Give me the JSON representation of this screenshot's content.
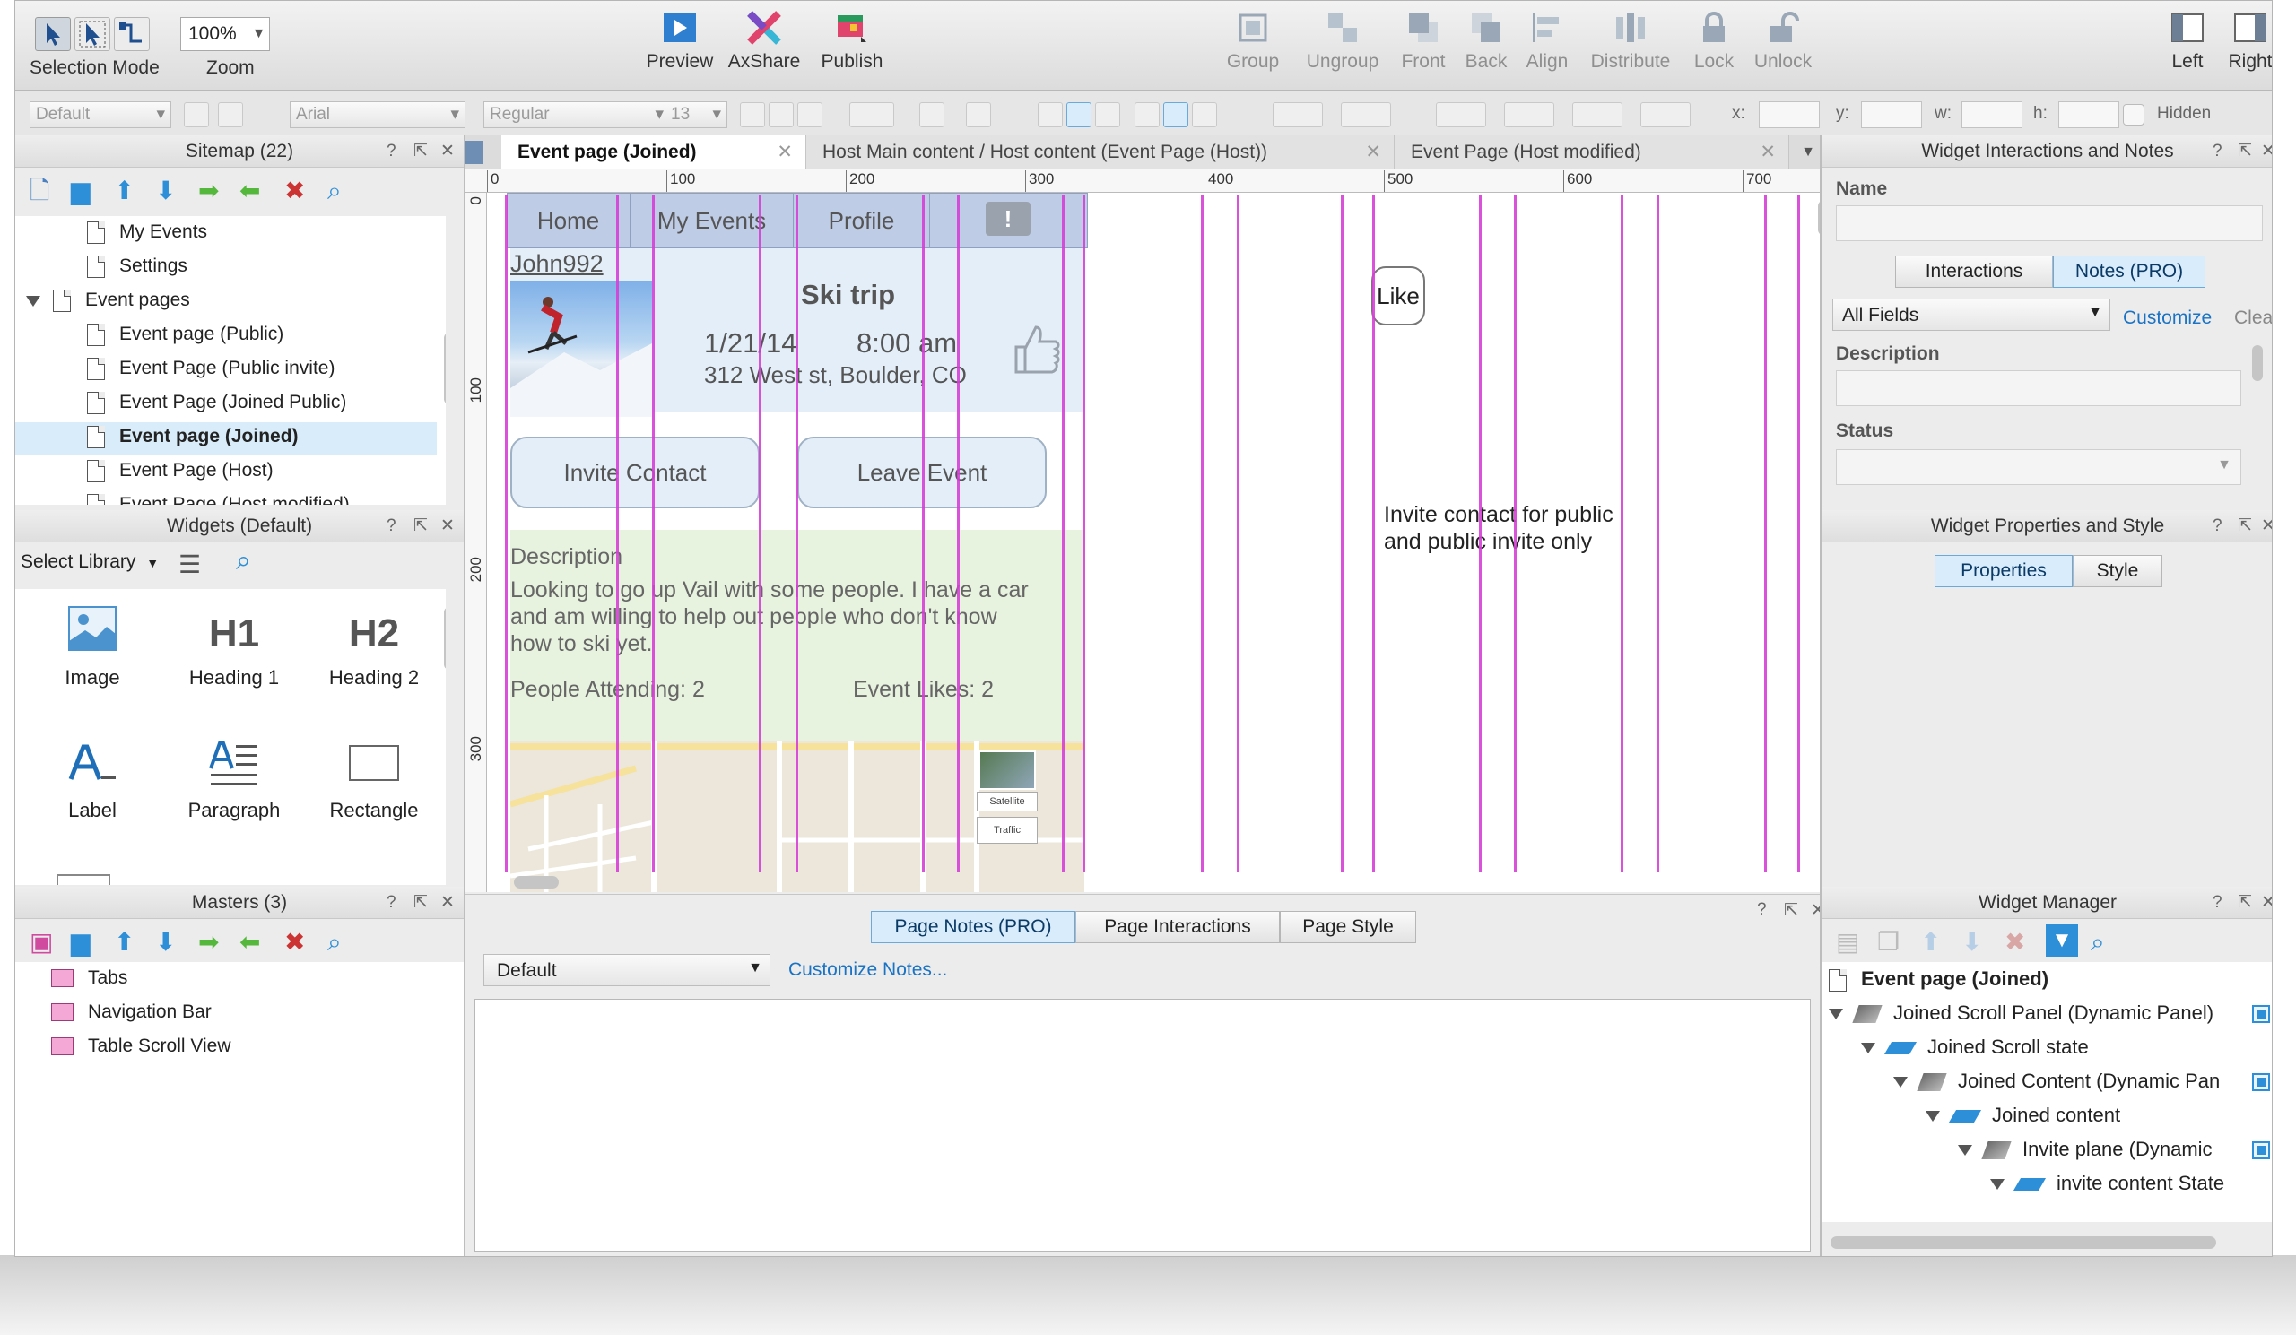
{
  "toolbar": {
    "selection_mode": "Selection Mode",
    "zoom_value": "100%",
    "zoom_label": "Zoom",
    "preview": "Preview",
    "axshare": "AxShare",
    "publish": "Publish",
    "group": "Group",
    "ungroup": "Ungroup",
    "front": "Front",
    "back": "Back",
    "align": "Align",
    "distribute": "Distribute",
    "lock": "Lock",
    "unlock": "Unlock",
    "left": "Left",
    "right": "Right"
  },
  "formatbar": {
    "style": "Default",
    "font": "Arial",
    "weight": "Regular",
    "size": "13",
    "x_label": "x:",
    "y_label": "y:",
    "w_label": "w:",
    "h_label": "h:",
    "hidden_label": "Hidden"
  },
  "sitemap": {
    "title": "Sitemap (22)",
    "items": [
      {
        "label": "My Events"
      },
      {
        "label": "Settings"
      },
      {
        "label": "Event pages"
      },
      {
        "label": "Event page (Public)"
      },
      {
        "label": "Event Page (Public invite)"
      },
      {
        "label": "Event Page (Joined Public)"
      },
      {
        "label": "Event page (Joined)"
      },
      {
        "label": "Event Page (Host)"
      },
      {
        "label": "Event Page (Host modified)"
      }
    ]
  },
  "widgets": {
    "title": "Widgets (Default)",
    "select_library": "Select Library",
    "items": [
      {
        "label": "Image"
      },
      {
        "label": "Heading 1",
        "glyph": "H1"
      },
      {
        "label": "Heading 2",
        "glyph": "H2"
      },
      {
        "label": "Label"
      },
      {
        "label": "Paragraph"
      },
      {
        "label": "Rectangle"
      }
    ]
  },
  "masters": {
    "title": "Masters (3)",
    "items": [
      {
        "label": "Tabs"
      },
      {
        "label": "Navigation Bar"
      },
      {
        "label": "Table Scroll View"
      }
    ]
  },
  "tabs": [
    {
      "label": "Event page (Joined)"
    },
    {
      "label": "Host Main content / Host content (Event Page (Host))"
    },
    {
      "label": "Event Page (Host modified)"
    }
  ],
  "ruler": {
    "h_ticks": [
      "0",
      "100",
      "200",
      "300",
      "400",
      "500",
      "600",
      "700"
    ],
    "v_ticks": [
      "0",
      "100",
      "200",
      "300"
    ]
  },
  "canvas": {
    "nav": [
      "Home",
      "My Events",
      "Profile"
    ],
    "username": "John992",
    "event_title": "Ski trip",
    "date": "1/21/14",
    "time": "8:00 am",
    "address": "312 West st, Boulder, CO",
    "invite_button": "Invite Contact",
    "leave_button": "Leave Event",
    "description_label": "Description",
    "description_text": "Looking to go up Vail with some people. I have a car and am willing to help out people who don't know how to ski yet.",
    "people_attending": "People Attending: 2",
    "event_likes": "Event Likes: 2",
    "like_button": "Like",
    "annotation": "Invite contact for public and public invite only",
    "map_satellite": "Satellite",
    "map_traffic": "Traffic"
  },
  "bottom": {
    "tabs": [
      "Page Notes (PRO)",
      "Page Interactions",
      "Page Style"
    ],
    "notes_select": "Default",
    "customize_notes": "Customize Notes..."
  },
  "interactions": {
    "title": "Widget Interactions and Notes",
    "name_label": "Name",
    "tab_interactions": "Interactions",
    "tab_notes": "Notes (PRO)",
    "fields_select": "All Fields",
    "customize": "Customize",
    "clear": "Clea",
    "description_label": "Description",
    "status_label": "Status"
  },
  "properties": {
    "title": "Widget Properties and Style",
    "tab_properties": "Properties",
    "tab_style": "Style"
  },
  "widget_manager": {
    "title": "Widget Manager",
    "rows": [
      {
        "label": "Event page (Joined)"
      },
      {
        "label": "Joined Scroll Panel (Dynamic Panel)"
      },
      {
        "label": "Joined Scroll state"
      },
      {
        "label": "Joined Content (Dynamic Pan"
      },
      {
        "label": "Joined content"
      },
      {
        "label": "Invite plane (Dynamic"
      },
      {
        "label": "invite content State"
      }
    ]
  },
  "colors": {
    "guide": "#d63fd6",
    "accent": "#2c8fd8",
    "nav_bg": "#bfcce6",
    "card_bg": "#e3eef8",
    "desc_bg": "#e7f3df"
  }
}
